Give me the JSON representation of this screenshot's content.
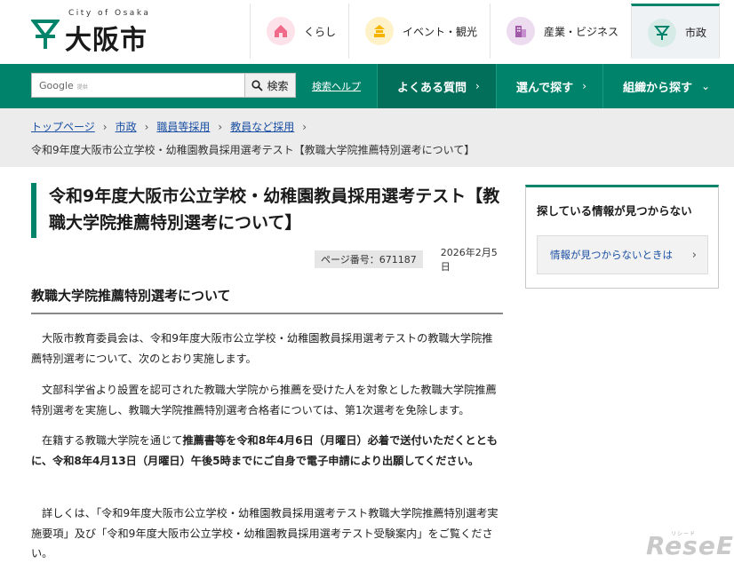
{
  "logo": {
    "en": "City of Osaka",
    "jp": "大阪市"
  },
  "topnav": [
    {
      "label": "くらし",
      "icon": "house-icon",
      "color": "#f06a8a"
    },
    {
      "label": "イベント・観光",
      "icon": "castle-icon",
      "color": "#f5b400"
    },
    {
      "label": "産業・ビジネス",
      "icon": "building-icon",
      "color": "#a05aa8"
    },
    {
      "label": "市政",
      "icon": "city-emblem-icon",
      "color": "#00836b"
    }
  ],
  "search": {
    "brand": "Google",
    "brand_sub": "提供",
    "button": "検索",
    "help": "検索ヘルプ"
  },
  "gnav": [
    {
      "label": "よくある質問",
      "chev": "›"
    },
    {
      "label": "選んで探す",
      "chev": "›"
    },
    {
      "label": "組織から探す",
      "chev": "⌄"
    }
  ],
  "breadcrumb": {
    "items": [
      "トップページ",
      "市政",
      "職員等採用",
      "教員など採用"
    ],
    "separator": "›",
    "current": "令和9年度大阪市公立学校・幼稚園教員採用選考テスト【教職大学院推薦特別選考について】"
  },
  "page": {
    "title": "令和9年度大阪市公立学校・幼稚園教員採用選考テスト【教職大学院推薦特別選考について】",
    "page_no_label": "ページ番号：671187",
    "date": "2026年2月5日",
    "section_heading": "教職大学院推薦特別選考について",
    "p1": "大阪市教育委員会は、令和9年度大阪市公立学校・幼稚園教員採用選考テストの教職大学院推薦特別選考について、次のとおり実施します。",
    "p2": "文部科学省より設置を認可された教職大学院から推薦を受けた人を対象とした教職大学院推薦特別選考を実施し、教職大学院推薦特別選考合格者については、第1次選考を免除します。",
    "p3_a": "在籍する教職大学院を通じて",
    "p3_b": "推薦書等を令和8年4月6日（月曜日）必着で送付いただくとともに、令和8年4月13日（月曜日）午後5時までにご自身で電子申請により出願してください。",
    "p4": "詳しくは、「令和9年度大阪市公立学校・幼稚園教員採用選考テスト教職大学院推薦特別選考実施要項」及び「令和9年度大阪市公立学校・幼稚園教員採用選考テスト受験案内」をご覧ください。"
  },
  "sidebar": {
    "heading": "探している情報が見つからない",
    "link": "情報が見つからないときは",
    "chev": "›"
  },
  "watermark": {
    "small": "リシード",
    "big": "ReseEd"
  },
  "colors": {
    "brand_green": "#00836b",
    "link": "#1a4fa3"
  }
}
